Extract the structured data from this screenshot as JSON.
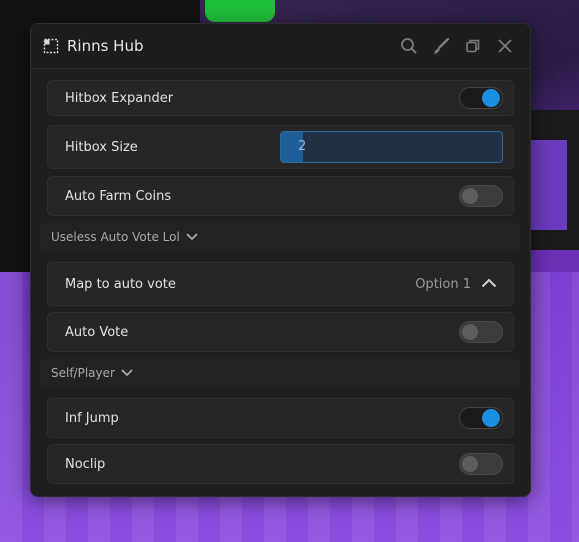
{
  "window": {
    "title": "Rinns Hub"
  },
  "titlebar": {
    "icons": [
      "grid-icon",
      "search-icon",
      "brush-icon",
      "restore-icon",
      "close-icon"
    ]
  },
  "rows": {
    "hitbox_expander": {
      "label": "Hitbox Expander",
      "enabled": true
    },
    "hitbox_size": {
      "label": "Hitbox Size",
      "value": "2",
      "fill": 0.1
    },
    "auto_farm_coins": {
      "label": "Auto Farm Coins",
      "enabled": false
    },
    "map_to_auto_vote": {
      "label": "Map to auto vote",
      "value": "Option 1"
    },
    "auto_vote": {
      "label": "Auto Vote",
      "enabled": false
    },
    "inf_jump": {
      "label": "Inf Jump",
      "enabled": true
    },
    "noclip": {
      "label": "Noclip",
      "enabled": false
    }
  },
  "sections": {
    "useless_auto_vote": "Useless Auto Vote Lol",
    "self_player": "Self/Player"
  },
  "colors": {
    "accent": "#1b8ee0",
    "window_bg": "#1f1f1f",
    "row_bg": "#262626"
  }
}
